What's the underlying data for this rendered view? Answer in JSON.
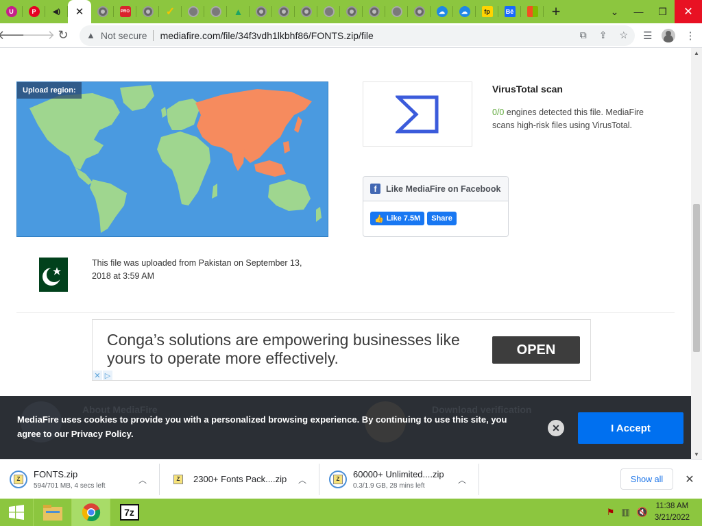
{
  "browser": {
    "tabs": [
      {
        "icon": "ublock-icon",
        "glyph": "U",
        "color": "#c6208a"
      },
      {
        "icon": "pinterest-icon",
        "glyph": "P",
        "color": "#e60023"
      },
      {
        "icon": "audio-playing-icon",
        "glyph": "◀)",
        "color": "#8cc63f"
      },
      {
        "icon": "close-tab-icon",
        "glyph": "✕",
        "color": "#ffffff",
        "active": true
      },
      {
        "icon": "globe-icon",
        "glyph": "",
        "color": "grey"
      },
      {
        "icon": "pro-icon",
        "glyph": "PRO",
        "color": "#d9232d"
      },
      {
        "icon": "globe-icon",
        "glyph": "",
        "color": "grey"
      },
      {
        "icon": "checkmark-icon",
        "glyph": "✓",
        "color": "#f5c400"
      },
      {
        "icon": "globe-icon",
        "glyph": "",
        "color": "dim"
      },
      {
        "icon": "globe-icon",
        "glyph": "",
        "color": "dim"
      },
      {
        "icon": "google-drive-icon",
        "glyph": "▲",
        "color": "#1fa463"
      },
      {
        "icon": "globe-icon",
        "glyph": "",
        "color": "grey"
      },
      {
        "icon": "globe-icon",
        "glyph": "",
        "color": "grey"
      },
      {
        "icon": "globe-icon",
        "glyph": "",
        "color": "grey"
      },
      {
        "icon": "globe-icon",
        "glyph": "",
        "color": "dim"
      },
      {
        "icon": "globe-icon",
        "glyph": "",
        "color": "grey"
      },
      {
        "icon": "globe-icon",
        "glyph": "",
        "color": "grey"
      },
      {
        "icon": "globe-icon",
        "glyph": "",
        "color": "dim"
      },
      {
        "icon": "globe-icon",
        "glyph": "",
        "color": "grey"
      },
      {
        "icon": "cloud-icon",
        "glyph": "☁",
        "color": "#1e88e5"
      },
      {
        "icon": "cloud-icon",
        "glyph": "☁",
        "color": "#1e88e5"
      },
      {
        "icon": "freepik-icon",
        "glyph": "fp",
        "color": "#1b1b1b"
      },
      {
        "icon": "behance-icon",
        "glyph": "Bē",
        "color": "#1769ff"
      },
      {
        "icon": "office-icon",
        "glyph": "■",
        "color": "#f25022"
      }
    ],
    "new_tab_label": "+",
    "window_controls": {
      "dropdown": "⌄",
      "minimize": "—",
      "restore": "❐",
      "close": "✕"
    },
    "address": {
      "security_label": "Not secure",
      "url": "mediafire.com/file/34f3vdh1lkbhf86/FONTS.zip/file"
    }
  },
  "page": {
    "map_label": "Upload region:",
    "virustotal": {
      "title": "VirusTotal scan",
      "count": "0/0",
      "desc": " engines detected this file. MediaFire scans high-risk files using VirusTotal."
    },
    "facebook": {
      "title": "Like MediaFire on Facebook",
      "like_label": "Like 7.5M",
      "share_label": "Share"
    },
    "upload_info": "This file was uploaded from Pakistan on September 13, 2018 at 3:59 AM",
    "ad": {
      "text": "Conga’s solutions are empowering businesses like yours to operate more effectively.",
      "button": "OPEN"
    },
    "cookie": {
      "text": "MediaFire uses cookies to provide you with a personalized browsing experience. By continuing to use this site, you agree to our Privacy Policy.",
      "accept": "I Accept",
      "ghost_left": "About MediaFire",
      "ghost_right": "Download verification"
    }
  },
  "downloads": {
    "items": [
      {
        "name": "FONTS.zip",
        "status": "594/701 MB, 4 secs left"
      },
      {
        "name": "2300+ Fonts Pack....zip",
        "status": ""
      },
      {
        "name": "60000+ Unlimited....zip",
        "status": "0.3/1.9 GB, 28 mins left"
      }
    ],
    "show_all": "Show all"
  },
  "taskbar": {
    "time": "11:38 AM",
    "date": "3/21/2022",
    "apps": [
      "file-explorer-icon",
      "chrome-icon",
      "7zip-icon"
    ]
  },
  "colors": {
    "chrome_frame": "#8cc63f",
    "accept_button": "#0070f0",
    "map_ocean": "#4a9ae0",
    "map_land": "#9fd68f",
    "map_highlight": "#f68b5e"
  }
}
